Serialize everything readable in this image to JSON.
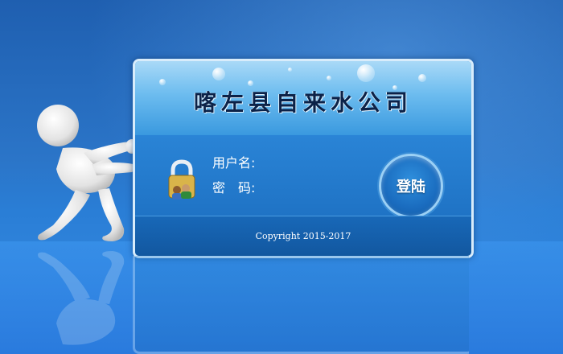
{
  "login_panel": {
    "title": "喀左县自来水公司",
    "username_label": "用户名:",
    "password_label": "密　码:",
    "username_value": "",
    "password_value": "",
    "login_button_label": "登陆",
    "copyright": "Copyright 2015-2017"
  },
  "icons": {
    "lock": "padlock-with-users-icon",
    "figure": "3d-figure-pushing"
  },
  "colors": {
    "background": "#2b75c8",
    "title_text": "#0c2248",
    "panel_border": "#d8ecfb",
    "label_text": "#ffffff"
  }
}
